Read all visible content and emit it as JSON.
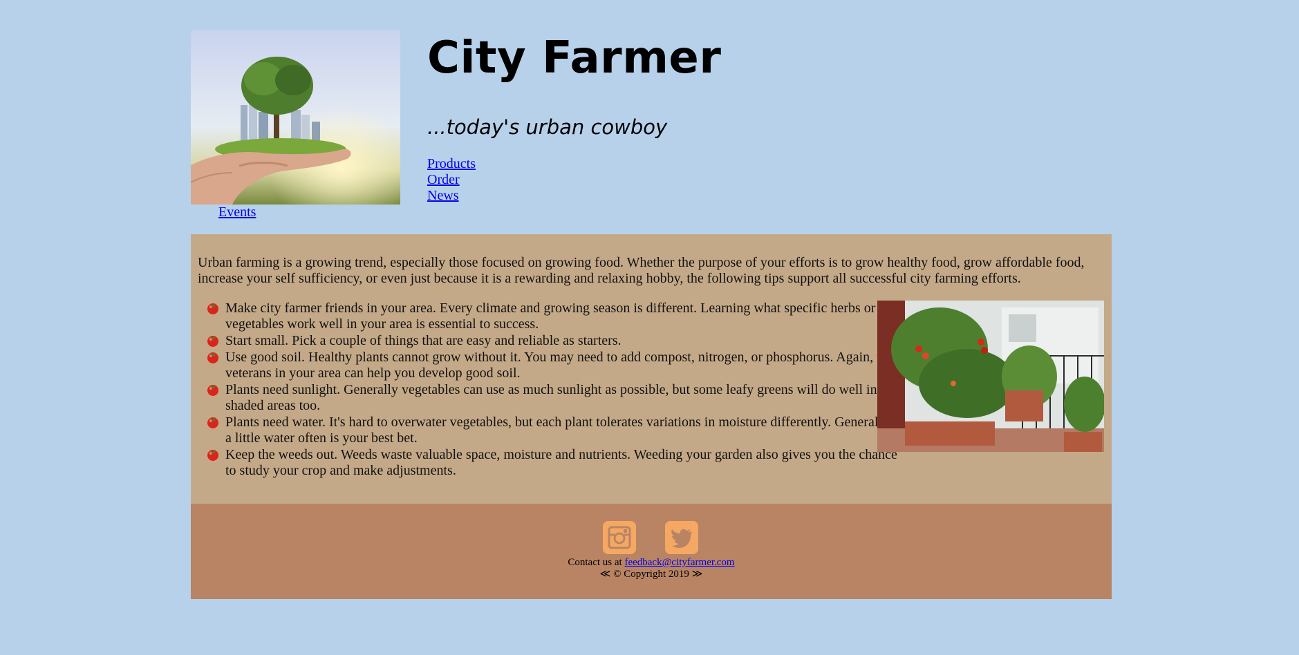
{
  "header": {
    "title": "City Farmer",
    "tagline": "...today's urban cowboy",
    "hero_image": "hand-holding-city-and-tree-image",
    "nav": [
      {
        "label": "Products"
      },
      {
        "label": "Order"
      },
      {
        "label": "News"
      },
      {
        "label": "Events"
      }
    ]
  },
  "main": {
    "intro": "Urban farming is a growing trend, especially those focused on growing food. Whether the purpose of your efforts is to grow healthy food, grow affordable food, increase your self sufficiency, or even just because it is a rewarding and relaxing hobby, the following tips support all successful city farming efforts.",
    "bullet_icon": "tomato-icon",
    "tips": [
      {
        "text": "Make city farmer friends in your area. Every climate and growing season is different. Learning what specific herbs or vegetables work well in your area is essential to success."
      },
      {
        "text": "Start small. Pick a couple of things that are easy and reliable as starters."
      },
      {
        "text": "Use good soil. Healthy plants cannot grow without it. You may need to add compost, nitrogen, or phosphorus. Again, the veterans in your area can help you develop good soil."
      },
      {
        "text": "Plants need sunlight. Generally vegetables can use as much sunlight as possible, but some leafy greens will do well in shaded areas too."
      },
      {
        "text": "Plants need water. It's hard to overwater vegetables, but each plant tolerates variations in moisture differently. Generally, a little water often is your best bet."
      },
      {
        "text": "Keep the weeds out. Weeds waste valuable space, moisture and nutrients. Weeding your garden also gives you the chance to study your crop and make adjustments."
      }
    ],
    "side_image": "balcony-tomato-garden-image"
  },
  "footer": {
    "social": [
      {
        "icon": "instagram-icon"
      },
      {
        "icon": "twitter-icon"
      }
    ],
    "contact_prefix": "Contact us at ",
    "contact_email": "feedback@cityfarmer.com",
    "copyright": "≪ © Copyright 2019 ≫"
  },
  "colors": {
    "page_background": "#b7d1ea",
    "main_background": "#c4a988",
    "footer_background": "#b98463",
    "social_icon": "#f5a863",
    "link": "#0000ee"
  }
}
